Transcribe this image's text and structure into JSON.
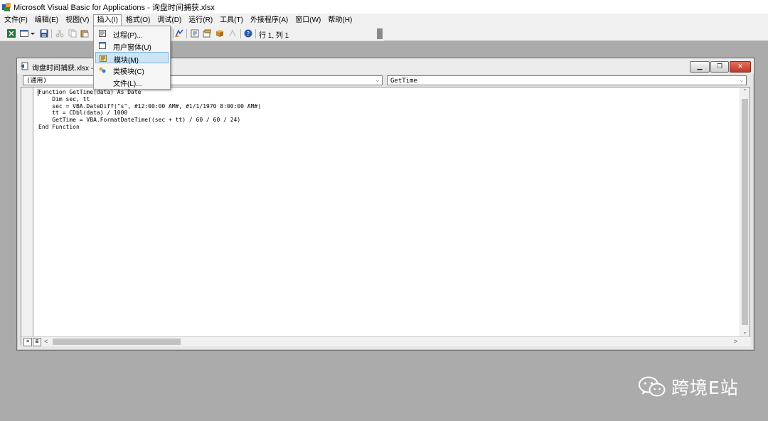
{
  "window": {
    "title": "Microsoft Visual Basic for Applications - 询盘时间捕获.xlsx"
  },
  "menubar": {
    "items": [
      "文件(F)",
      "编辑(E)",
      "视图(V)",
      "插入(I)",
      "格式(O)",
      "调试(D)",
      "运行(R)",
      "工具(T)",
      "外接程序(A)",
      "窗口(W)",
      "帮助(H)"
    ],
    "active_index": 3
  },
  "toolbar": {
    "cursor_position": "行 1, 列 1"
  },
  "insert_menu": {
    "items": [
      {
        "label": "过程(P)...",
        "icon": "procedure-icon"
      },
      {
        "label": "用户窗体(U)",
        "icon": "userform-icon"
      },
      {
        "label": "模块(M)",
        "icon": "module-icon",
        "highlighted": true
      },
      {
        "label": "类模块(C)",
        "icon": "class-module-icon"
      },
      {
        "label": "文件(L)...",
        "icon": ""
      }
    ]
  },
  "code_window": {
    "title": "询盘时间捕获.xlsx - ",
    "object_combo": "(通用)",
    "procedure_combo": "GetTime",
    "lines": [
      "Function GetTime(data) As Date",
      "    Dim sec, tt",
      "    sec = VBA.DateDiff(\"s\", #12:00:00 AM#, #1/1/1970 8:00:00 AM#)",
      "    tt = CDbl(data) / 1000",
      "    GetTime = VBA.FormatDateTime((sec + tt) / 60 / 60 / 24)",
      "End Function"
    ]
  },
  "watermark": {
    "text": "跨境E站",
    "icon": "wechat-icon"
  }
}
